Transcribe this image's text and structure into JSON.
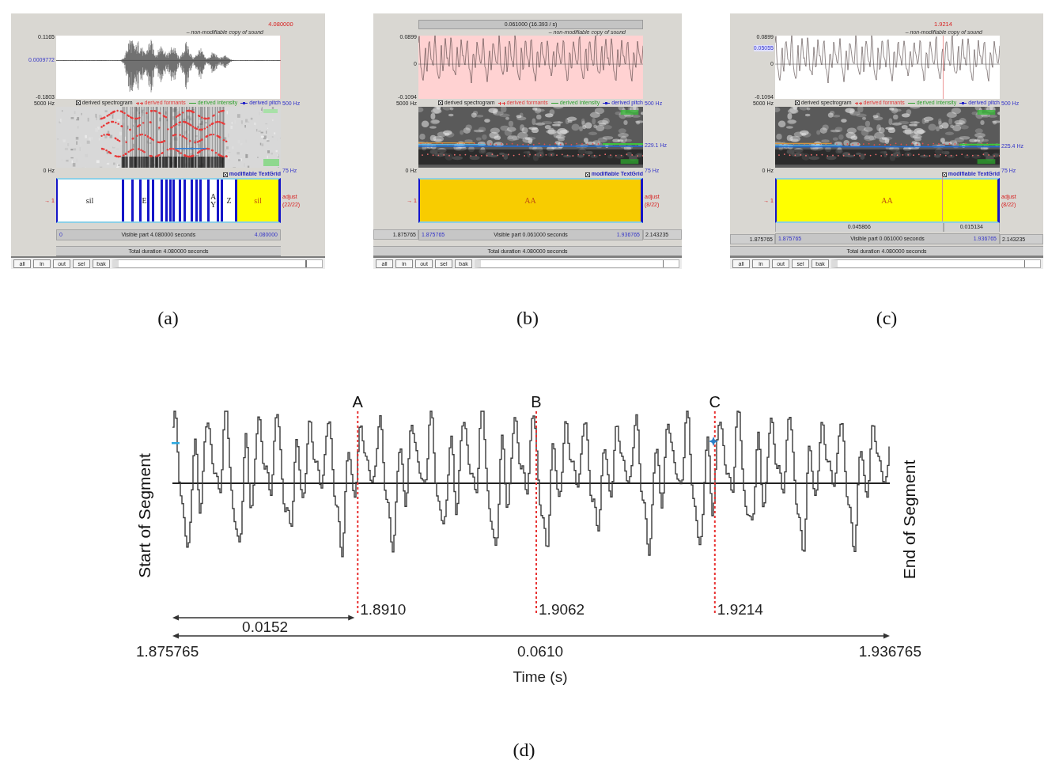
{
  "panels": [
    {
      "caption": "(a)",
      "top_time": "4.080000",
      "sound": {
        "title": "– non-modifiable copy of sound",
        "kind": "utterance",
        "selected": false,
        "max": "0.1165",
        "cursor": "0.0009772",
        "min": "-0.1803"
      },
      "spectrogram": {
        "kind": "utterance",
        "freq_max": "5000 Hz",
        "freq_min": "0 Hz",
        "pitch_max": "500 Hz",
        "pitch_min": "75 Hz",
        "toggle": {
          "label": "derived spectrogram",
          "checked": true
        },
        "overlays": [
          {
            "label": "derived formants",
            "kind": "crosses",
            "color": "#e03a3a"
          },
          {
            "label": "derived intensity",
            "kind": "line",
            "color": "#2fa02f"
          },
          {
            "label": "derived pitch",
            "kind": "dot",
            "color": "#2323c8"
          }
        ]
      },
      "textgrid": {
        "title": "modifiable TextGrid",
        "checked": true,
        "tier_number": "→ 1",
        "tier_name": "adjust",
        "tier_count": "(22/22)",
        "intervals": [
          {
            "label": "sil",
            "selected": false
          },
          {
            "selected": false
          },
          {
            "selected": false
          },
          {
            "label": "E",
            "selected": false
          },
          {
            "selected": false
          },
          {
            "selected": false
          },
          {
            "selected": false
          },
          {
            "selected": false
          },
          {
            "selected": false
          },
          {
            "selected": false
          },
          {
            "selected": false
          },
          {
            "selected": false
          },
          {
            "selected": false
          },
          {
            "selected": false
          },
          {
            "selected": false
          },
          {
            "label": "AY",
            "selected": false
          },
          {
            "selected": false
          },
          {
            "label": "Z",
            "selected": false
          },
          {
            "label": "sil",
            "selected": true
          }
        ]
      },
      "time_row": {
        "start": "0",
        "label": "Visible part 4.080000 seconds",
        "end": "4.080000"
      },
      "total": "Total duration 4.080000 seconds",
      "buttons": [
        "all",
        "in",
        "out",
        "sel",
        "bak"
      ]
    },
    {
      "caption": "(b)",
      "top_bar": "0.061000 (16.393 / s)",
      "sound": {
        "title": "– non-modifiable copy of sound",
        "kind": "segment",
        "selected": true,
        "max": "0.0899",
        "zero": "0",
        "min": "-0.1094"
      },
      "spectrogram": {
        "kind": "segment",
        "freq_max": "5000 Hz",
        "freq_min": "0 Hz",
        "pitch_max": "500 Hz",
        "pitch_reading": "229.1 Hz",
        "pitch_min": "75 Hz",
        "toggle": {
          "label": "derived spectrogram",
          "checked": true
        },
        "overlays": [
          {
            "label": "derived formants",
            "kind": "crosses",
            "color": "#e03a3a"
          },
          {
            "label": "derived intensity",
            "kind": "line",
            "color": "#2fa02f"
          },
          {
            "label": "derived pitch",
            "kind": "dot",
            "color": "#2323c8"
          }
        ]
      },
      "textgrid": {
        "title": "modifiable TextGrid",
        "checked": true,
        "tier_number": "→ 1",
        "tier_name": "adjust",
        "tier_count": "(8/22)",
        "intervals": [
          {
            "label": "AA",
            "selected": true
          }
        ]
      },
      "time_row": {
        "outer_start": "1.875765",
        "start": "1.875765",
        "label": "Visible part 0.061000 seconds",
        "end": "1.936765",
        "outer_end": "2.143235"
      },
      "total": "Total duration 4.080000 seconds",
      "buttons": [
        "all",
        "in",
        "out",
        "sel",
        "bak"
      ]
    },
    {
      "caption": "(c)",
      "top_time": "1.9214",
      "sound": {
        "title": "– non-modifiable copy of sound",
        "kind": "segment",
        "selected": false,
        "max": "0.0899",
        "cursor": "0.05055",
        "zero": "0",
        "min": "-0.1094"
      },
      "spectrogram": {
        "kind": "segment",
        "freq_max": "5000 Hz",
        "freq_min": "0 Hz",
        "pitch_max": "500 Hz",
        "pitch_reading": "225.4 Hz",
        "pitch_min": "75 Hz",
        "toggle": {
          "label": "derived spectrogram",
          "checked": true
        },
        "overlays": [
          {
            "label": "derived formants",
            "kind": "crosses",
            "color": "#e03a3a"
          },
          {
            "label": "derived intensity",
            "kind": "line",
            "color": "#2fa02f"
          },
          {
            "label": "derived pitch",
            "kind": "dot",
            "color": "#2323c8"
          }
        ]
      },
      "textgrid": {
        "title": "modifiable TextGrid",
        "checked": true,
        "tier_number": "→ 1",
        "tier_name": "adjust",
        "tier_count": "(8/22)",
        "intervals": [
          {
            "label": "AA",
            "selected": true
          }
        ]
      },
      "cursor_durations": [
        "0.045866",
        "0.015134"
      ],
      "time_row": {
        "outer_start": "1.875765",
        "start": "1.875765",
        "label": "Visible part 0.061000 seconds",
        "end": "1.936765",
        "outer_end": "2.143235"
      },
      "total": "Total duration 4.080000 seconds",
      "buttons": [
        "all",
        "in",
        "out",
        "sel",
        "bak"
      ]
    }
  ],
  "figure": {
    "caption": "(d)",
    "start_label": "Start of Segment",
    "end_label": "End of Segment",
    "markers": [
      {
        "label": "A",
        "time": "1.8910"
      },
      {
        "label": "B",
        "time": "1.9062"
      },
      {
        "label": "C",
        "time": "1.9214"
      }
    ],
    "first_gap": "0.0152",
    "axis_start": "1.875765",
    "axis_length": "0.0610",
    "axis_end": "1.936765",
    "axis_title": "Time (s)"
  }
}
